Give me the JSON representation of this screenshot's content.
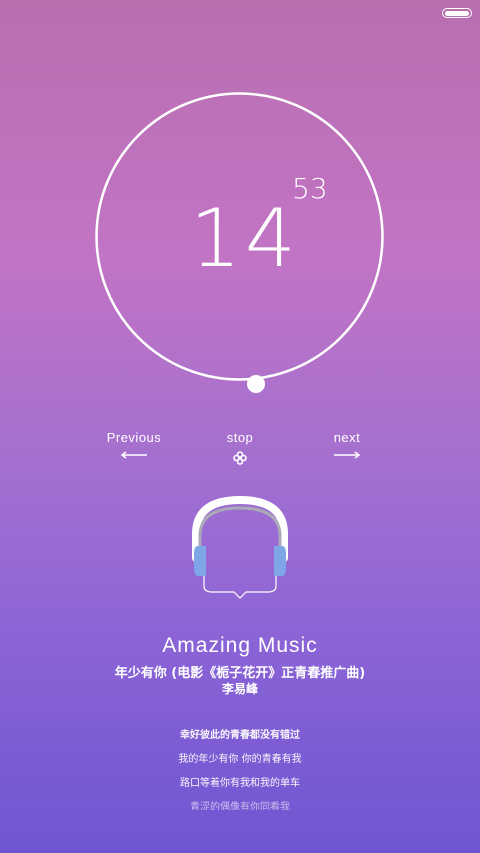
{
  "clock": {
    "hour": "14",
    "minute": "53",
    "progress": 0.5
  },
  "controls": {
    "previous_label": "Previous",
    "stop_label": "stop",
    "next_label": "next",
    "previous_icon": "arrow-left-icon",
    "stop_icon": "flower-icon",
    "next_icon": "arrow-right-icon"
  },
  "track": {
    "app_title": "Amazing Music",
    "song": "年少有你 (电影《栀子花开》正青春推广曲)",
    "artist": "李易峰"
  },
  "lyrics": [
    "幸好彼此的青春都没有错过",
    "我的年少有你 你的青春有我",
    "路口等着你有我和我的单车",
    "青涩的偶像有你同看我"
  ]
}
